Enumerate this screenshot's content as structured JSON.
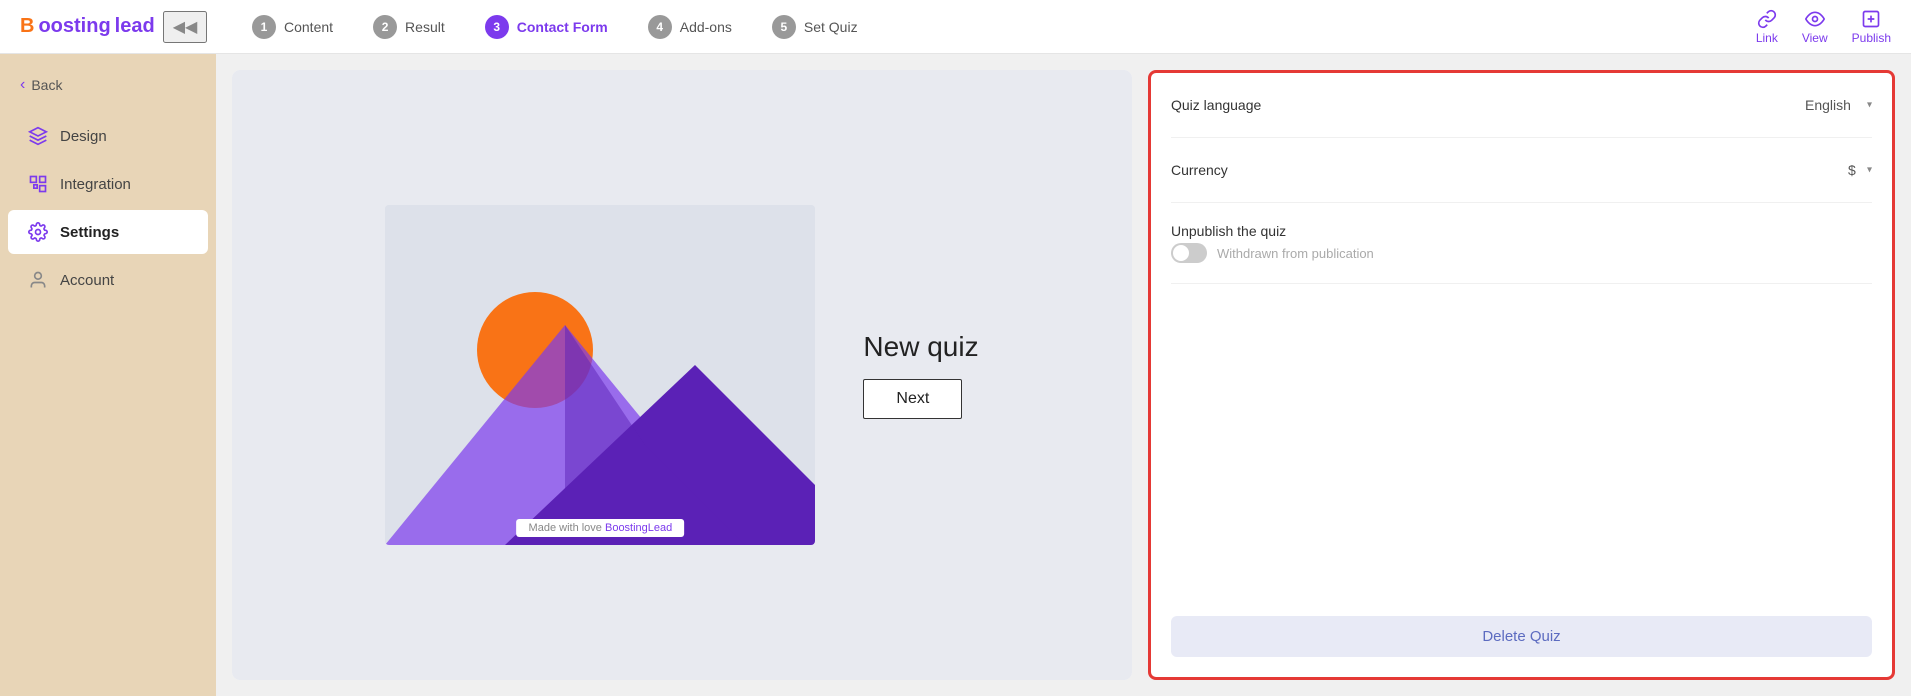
{
  "logo": {
    "brand": "B",
    "text": "oosting",
    "lead": "lead"
  },
  "header": {
    "collapse_icon": "◀",
    "steps": [
      {
        "num": "1",
        "label": "Content",
        "active": false
      },
      {
        "num": "2",
        "label": "Result",
        "active": false
      },
      {
        "num": "3",
        "label": "Contact Form",
        "active": true
      },
      {
        "num": "4",
        "label": "Add-ons",
        "active": false
      },
      {
        "num": "5",
        "label": "Set Quiz",
        "active": false
      }
    ],
    "actions": [
      {
        "key": "link",
        "label": "Link",
        "icon": "link"
      },
      {
        "key": "view",
        "label": "View",
        "icon": "view"
      },
      {
        "key": "publish",
        "label": "Publish",
        "icon": "publish"
      }
    ]
  },
  "sidebar": {
    "back_label": "Back",
    "items": [
      {
        "key": "design",
        "label": "Design",
        "active": false
      },
      {
        "key": "integration",
        "label": "Integration",
        "active": false
      },
      {
        "key": "settings",
        "label": "Settings",
        "active": true
      },
      {
        "key": "account",
        "label": "Account",
        "active": false
      }
    ]
  },
  "preview": {
    "quiz_title": "New quiz",
    "next_button": "Next",
    "watermark_prefix": "Made with love ",
    "watermark_brand": "BoostingLead"
  },
  "settings_panel": {
    "quiz_language_label": "Quiz language",
    "quiz_language_value": "English",
    "currency_label": "Currency",
    "currency_value": "$",
    "unpublish_label": "Unpublish the quiz",
    "toggle_text": "Withdrawn from publication",
    "delete_button": "Delete Quiz"
  }
}
